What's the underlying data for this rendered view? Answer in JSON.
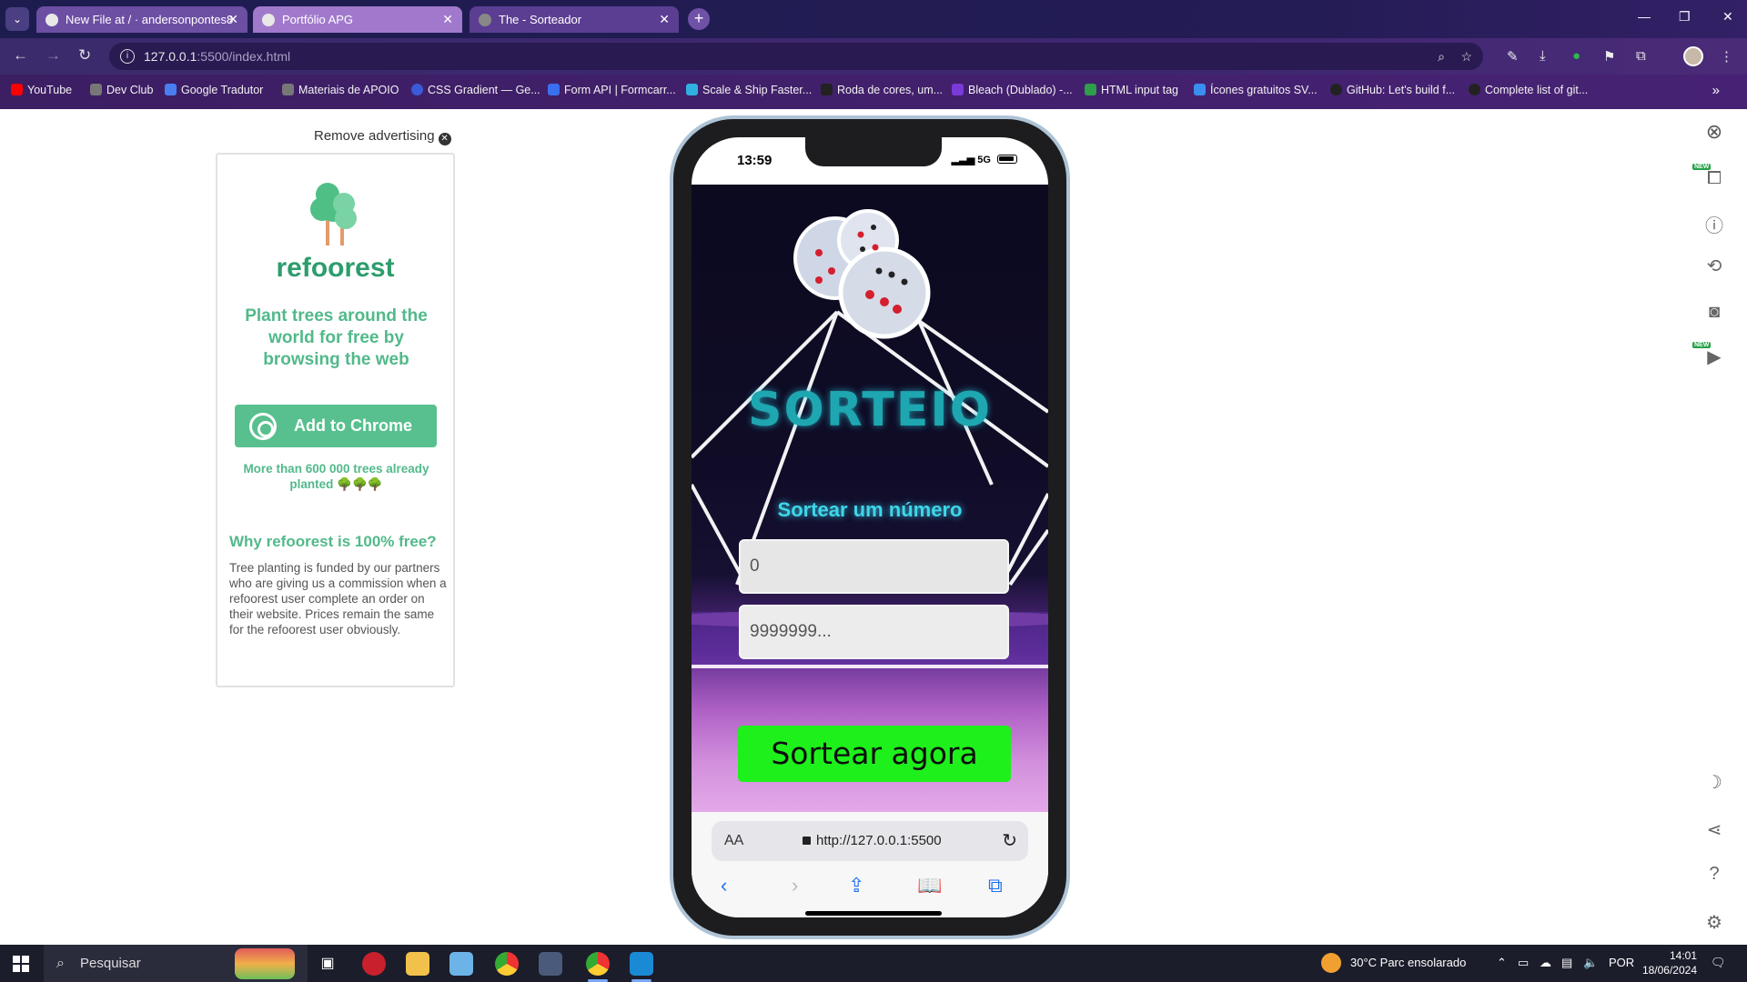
{
  "browser": {
    "tabs": [
      {
        "title": "New File at / · andersonpontes8",
        "active": false
      },
      {
        "title": "Portfólio APG",
        "active": false
      },
      {
        "title": "The - Sorteador",
        "active": true
      }
    ],
    "address": {
      "host": "127.0.0.1",
      "rest": ":5500/index.html"
    },
    "bookmarks": [
      {
        "label": "YouTube",
        "color": "#ff0000"
      },
      {
        "label": "Dev Club",
        "color": "#888888"
      },
      {
        "label": "Google Tradutor",
        "color": "#4a7ef0"
      },
      {
        "label": "Materiais de APOIO",
        "color": "#888888"
      },
      {
        "label": "CSS Gradient — Ge...",
        "color": "#3a5bd9"
      },
      {
        "label": "Form API | Formcarr...",
        "color": "#3a6ff0"
      },
      {
        "label": "Scale & Ship Faster...",
        "color": "#30b0e0"
      },
      {
        "label": "Roda de cores, um...",
        "color": "#222222"
      },
      {
        "label": "Bleach (Dublado) -...",
        "color": "#7a3ad9"
      },
      {
        "label": "HTML input tag",
        "color": "#2e9e4a"
      },
      {
        "label": "Ícones gratuitos SV...",
        "color": "#3a8ef0"
      },
      {
        "label": "GitHub: Let's build f...",
        "color": "#222222"
      },
      {
        "label": "Complete list of git...",
        "color": "#222222"
      }
    ]
  },
  "ad": {
    "remove_label": "Remove advertising",
    "brand": "refoorest",
    "tagline": "Plant trees around the world for free by browsing the web",
    "cta": "Add to Chrome",
    "count": "More than 600 000 trees already planted 🌳🌳🌳",
    "why_title": "Why refoorest is 100% free?",
    "why_body": "Tree planting is funded by our partners who are giving us a commission when a refoorest user complete an order on their website. Prices remain the same for the refoorest user obviously."
  },
  "phone": {
    "time": "13:59",
    "network": "5G",
    "app": {
      "title": "SORTEIO",
      "subtitle": "Sortear um número",
      "min_placeholder": "0",
      "max_placeholder": "9999999...",
      "button": "Sortear agora"
    },
    "safari": {
      "aa_label": "AA",
      "url": "http://127.0.0.1:5500"
    }
  },
  "taskbar": {
    "search_placeholder": "Pesquisar",
    "weather": "30°C  Parc ensolarado",
    "language": "POR",
    "time": "14:01",
    "date": "18/06/2024"
  },
  "colors": {
    "accent_green": "#1ef01c",
    "title_teal": "#1ea7b0",
    "subtitle_cyan": "#3fd6e8",
    "refoorest_green": "#58c08e"
  }
}
